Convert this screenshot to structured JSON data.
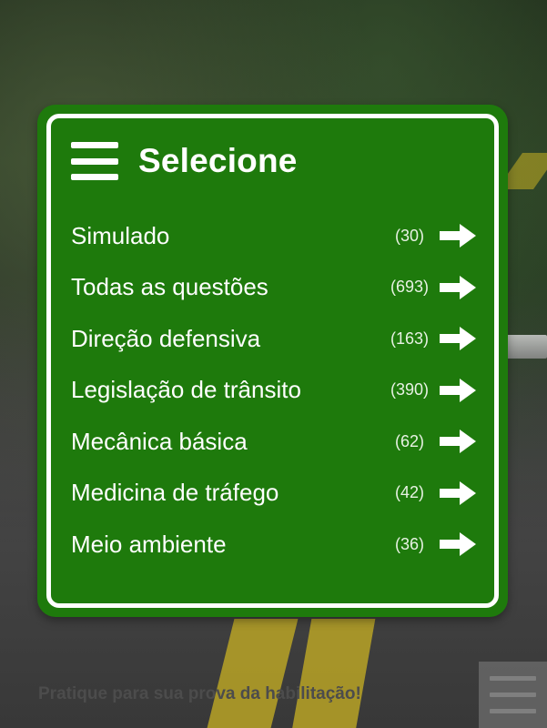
{
  "header": {
    "title": "Selecione",
    "menu_icon": "hamburger-icon"
  },
  "menu": {
    "items": [
      {
        "label": "Simulado",
        "count": "(30)",
        "icon": "arrow-right-icon"
      },
      {
        "label": "Todas as questões",
        "count": "(693)",
        "icon": "arrow-right-icon"
      },
      {
        "label": "Direção defensiva",
        "count": "(163)",
        "icon": "arrow-right-icon"
      },
      {
        "label": "Legislação de trânsito",
        "count": "(390)",
        "icon": "arrow-right-icon"
      },
      {
        "label": "Mecânica básica",
        "count": "(62)",
        "icon": "arrow-right-icon"
      },
      {
        "label": "Medicina de tráfego",
        "count": "(42)",
        "icon": "arrow-right-icon"
      },
      {
        "label": "Meio ambiente",
        "count": "(36)",
        "icon": "arrow-right-icon"
      }
    ]
  },
  "footer": {
    "tagline": "Pratique para sua prova da habilitação!",
    "menu_icon": "hamburger-icon"
  },
  "colors": {
    "sign_green": "#1e7a0c",
    "text_white": "#ffffff"
  }
}
